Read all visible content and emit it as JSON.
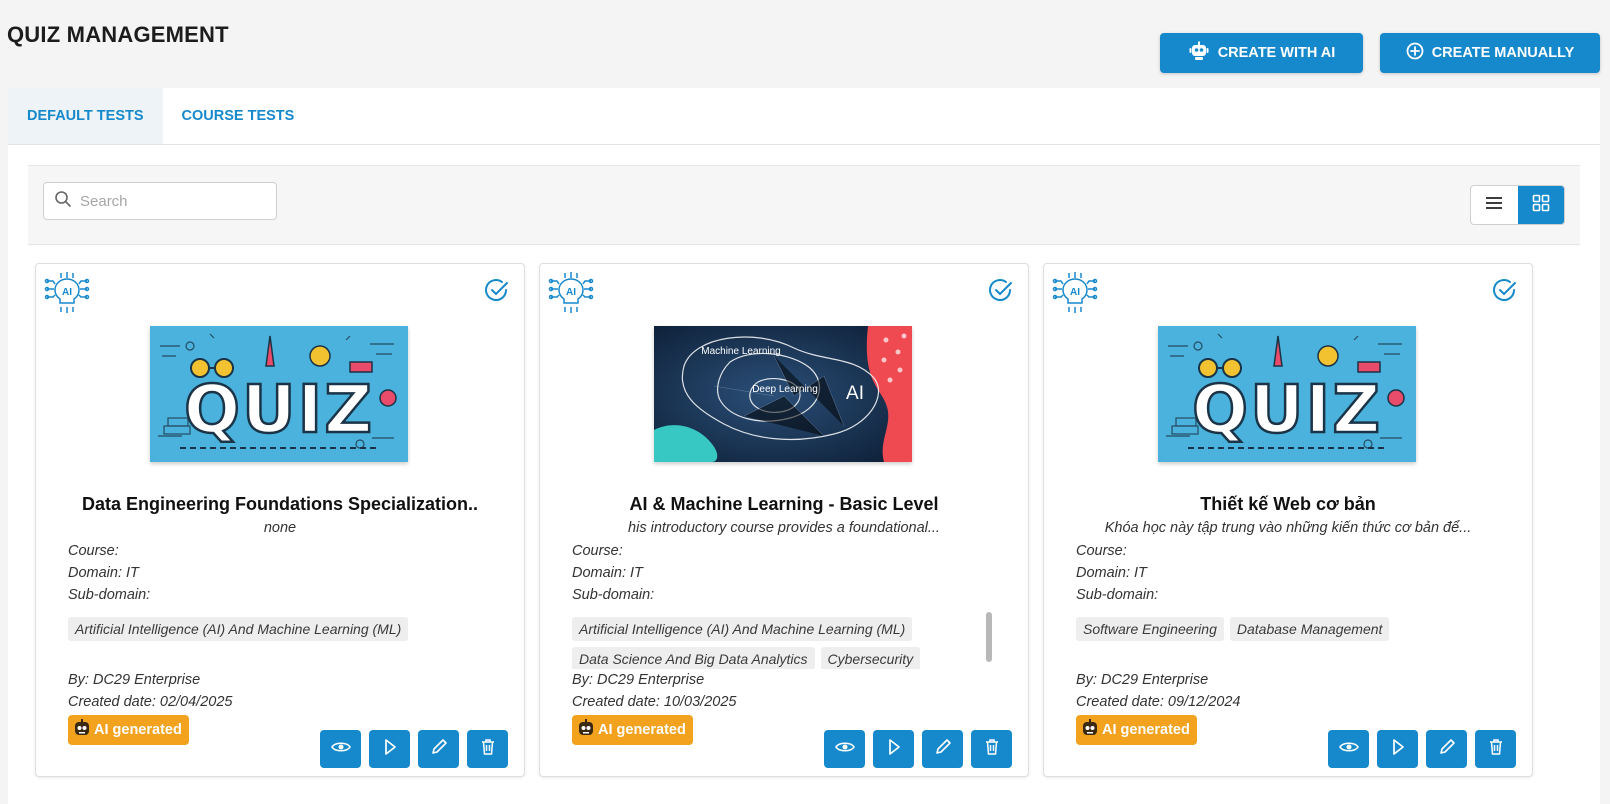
{
  "header": {
    "title": "QUIZ MANAGEMENT",
    "create_ai_label": "CREATE WITH AI",
    "create_manual_label": "CREATE MANUALLY"
  },
  "tabs": [
    {
      "label": "DEFAULT TESTS",
      "active": true
    },
    {
      "label": "COURSE TESTS",
      "active": false
    }
  ],
  "toolbar": {
    "search_placeholder": "Search",
    "search_value": "",
    "view_mode": "grid"
  },
  "labels": {
    "course": "Course:",
    "domain": "Domain: IT",
    "subdomain": "Sub-domain:",
    "ai_badge": "AI generated"
  },
  "cards": [
    {
      "title": "Data Engineering Foundations Specialization..",
      "description": "none",
      "thumbnail": "quiz-banner",
      "tags": [
        "Artificial Intelligence (AI) And Machine Learning (ML)"
      ],
      "by": "By: DC29 Enterprise",
      "created": "Created date: 02/04/2025"
    },
    {
      "title": "AI & Machine Learning - Basic Level",
      "description": "his introductory course provides a foundational...",
      "thumbnail": "ml-diagram",
      "thumbnail_text": {
        "ml": "Machine Learning",
        "dl": "Deep Learning",
        "ai": "AI"
      },
      "tags": [
        "Artificial Intelligence (AI) And Machine Learning (ML)",
        "Data Science And Big Data Analytics",
        "Cybersecurity"
      ],
      "by": "By: DC29 Enterprise",
      "created": "Created date: 10/03/2025"
    },
    {
      "title": "Thiết kế Web cơ bản",
      "description": "Khóa học này tập trung vào những kiến thức cơ bản để...",
      "thumbnail": "quiz-banner",
      "tags": [
        "Software Engineering",
        "Database Management"
      ],
      "by": "By: DC29 Enterprise",
      "created": "Created date: 09/12/2024"
    }
  ],
  "colors": {
    "primary": "#1689cc",
    "badge": "#f3a21d",
    "quiz_bg": "#4ab2dc"
  },
  "icons": [
    "robot-icon",
    "plus-circle-icon",
    "search-icon",
    "list-view-icon",
    "grid-view-icon",
    "ai-brain-icon",
    "check-circle-icon",
    "eye-icon",
    "play-icon",
    "pencil-icon",
    "trash-icon"
  ]
}
